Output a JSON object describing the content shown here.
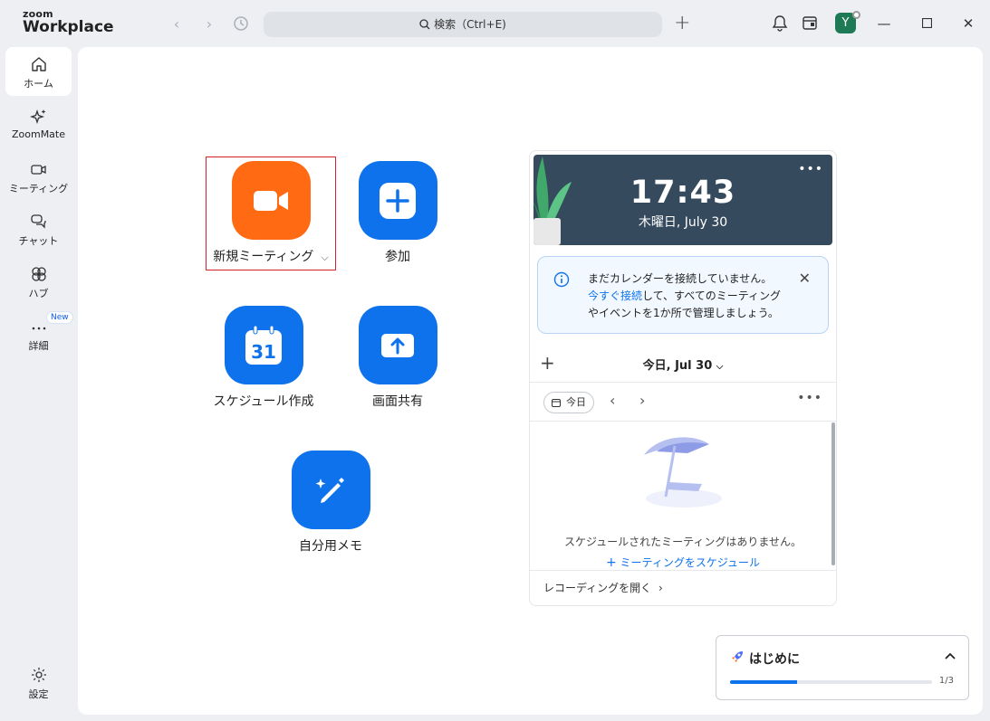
{
  "app": {
    "logo_small": "zoom",
    "logo_big": "Workplace"
  },
  "search": {
    "label": "検索（Ctrl+E)"
  },
  "user": {
    "avatar_initial": "Y"
  },
  "sidebar": {
    "items": [
      {
        "label": "ホーム",
        "icon": "home-icon",
        "active": true
      },
      {
        "label": "ZoomMate",
        "icon": "sparkle-icon"
      },
      {
        "label": "ミーティング",
        "icon": "video-camera-icon"
      },
      {
        "label": "チャット",
        "icon": "chat-bubbles-icon"
      },
      {
        "label": "ハブ",
        "icon": "hub-icon"
      },
      {
        "label": "詳細",
        "icon": "more-dots-icon",
        "badge": "New"
      }
    ],
    "settings_label": "設定"
  },
  "actions": {
    "new_meeting": "新規ミーティング",
    "join": "参加",
    "schedule": "スケジュール作成",
    "calendar_day": "31",
    "share_screen": "画面共有",
    "notes": "自分用メモ"
  },
  "calendar": {
    "time": "17:43",
    "date": "木曜日, July 30",
    "notice_pre": "まだカレンダーを接続していません。",
    "notice_link": "今すぐ接続",
    "notice_post": "して、すべてのミーティングやイベントを1か所で管理しましょう。",
    "today_label": "今日, Jul 30",
    "today_pill": "今日",
    "empty_message": "スケジュールされたミーティングはありません。",
    "schedule_link": "ミーティングをスケジュール",
    "recordings_link": "レコーディングを開く"
  },
  "getting_started": {
    "title": "はじめに",
    "progress_text": "1/3",
    "progress": 0.333
  },
  "colors": {
    "accent": "#0e72ed",
    "orange": "#ff6a13",
    "highlight": "#d4222a",
    "header_bg": "#364a5e"
  }
}
